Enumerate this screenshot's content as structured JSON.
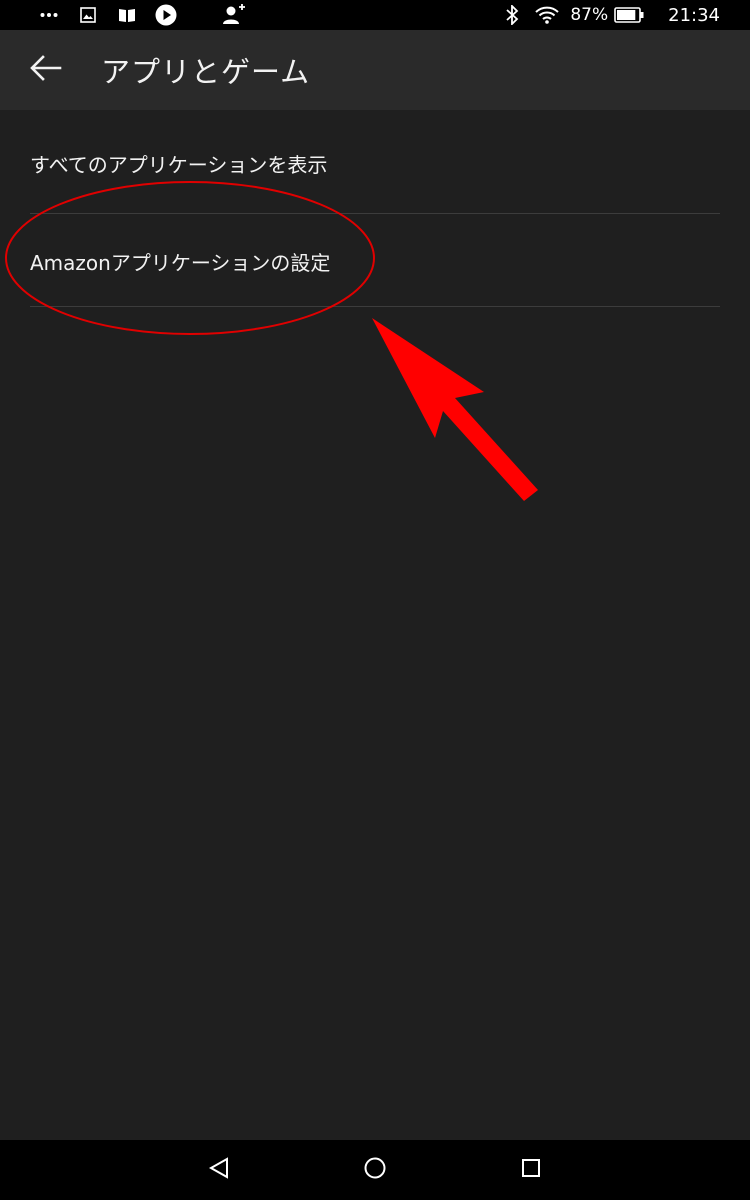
{
  "status_bar": {
    "left_icons": [
      "more-dots-icon",
      "image-icon",
      "book-icon",
      "play-icon",
      "add-person-icon"
    ],
    "right_icons": [
      "bluetooth-icon",
      "wifi-icon",
      "battery-icon"
    ],
    "battery_percent": "87%",
    "battery_level": 0.87,
    "time": "21:34"
  },
  "app_bar": {
    "back_icon": "arrow-left-icon",
    "title": "アプリとゲーム"
  },
  "menu": {
    "items": [
      {
        "label": "すべてのアプリケーションを表示"
      },
      {
        "label": "Amazonアプリケーションの設定"
      }
    ]
  },
  "annotation": {
    "color": "#ff0000",
    "shapes": [
      "red-ellipse",
      "red-arrow"
    ]
  },
  "nav_bar": {
    "icons": [
      "back-triangle-icon",
      "home-circle-icon",
      "recents-square-icon"
    ]
  }
}
